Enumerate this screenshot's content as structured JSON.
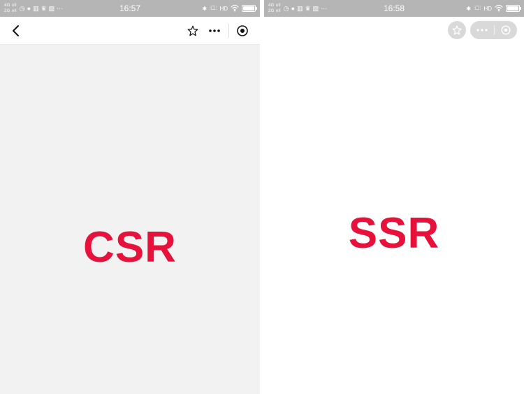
{
  "left": {
    "statusbar": {
      "network_top": "4G ııll",
      "network_bottom": "2G ııll",
      "time": "16:57",
      "right_text": "HD"
    },
    "content_label": "CSR"
  },
  "right": {
    "statusbar": {
      "network_top": "4G ııll",
      "network_bottom": "2G ııll",
      "time": "16:58",
      "right_text": "HD"
    },
    "content_label": "SSR"
  },
  "colors": {
    "label": "#e6123b",
    "statusbar": "#b5b5b5"
  }
}
